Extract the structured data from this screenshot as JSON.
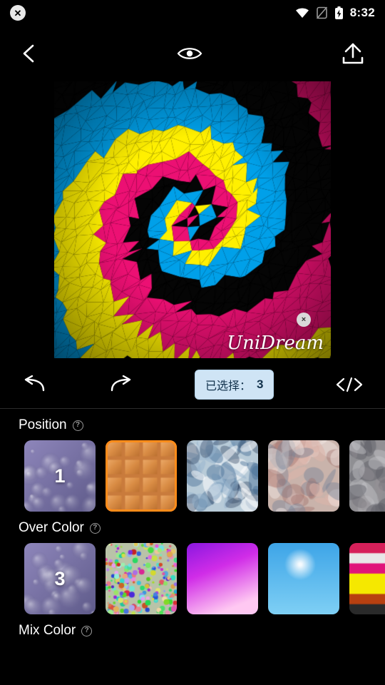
{
  "status_bar": {
    "close_icon": "close-circle-icon",
    "wifi_icon": "wifi-icon",
    "sim_icon": "sim-off-icon",
    "battery_icon": "battery-charging-icon",
    "time": "8:32"
  },
  "toolbar": {
    "back_icon": "chevron-left-icon",
    "preview_icon": "eye-icon",
    "share_icon": "upload-icon"
  },
  "canvas": {
    "watermark": "UniDream",
    "watermark_close": "×"
  },
  "action_bar": {
    "undo_icon": "undo-arrow-icon",
    "redo_icon": "redo-arrow-icon",
    "selected_label": "已选择：",
    "selected_count": "3",
    "code_icon": "code-brackets-icon"
  },
  "panel": {
    "sections": [
      {
        "title": "Position",
        "help": "?",
        "items": [
          {
            "name": "position-thumb-1",
            "badge": "1",
            "selected": false,
            "style": "bubbles-purple"
          },
          {
            "name": "position-thumb-2",
            "badge": "",
            "selected": true,
            "style": "waffle-orange"
          },
          {
            "name": "position-thumb-3",
            "badge": "",
            "selected": false,
            "style": "ice-blue"
          },
          {
            "name": "position-thumb-4",
            "badge": "",
            "selected": false,
            "style": "marble-pink"
          },
          {
            "name": "position-thumb-5",
            "badge": "",
            "selected": false,
            "style": "grey-rock"
          }
        ]
      },
      {
        "title": "Over Color",
        "help": "?",
        "items": [
          {
            "name": "overcolor-thumb-1",
            "badge": "3",
            "selected": false,
            "style": "bubbles-purple"
          },
          {
            "name": "overcolor-thumb-2",
            "badge": "",
            "selected": false,
            "style": "confetti"
          },
          {
            "name": "overcolor-thumb-3",
            "badge": "",
            "selected": false,
            "style": "magenta-gradient"
          },
          {
            "name": "overcolor-thumb-4",
            "badge": "",
            "selected": false,
            "style": "blue-moon"
          },
          {
            "name": "overcolor-thumb-5",
            "badge": "",
            "selected": false,
            "style": "color-stripes"
          }
        ]
      },
      {
        "title": "Mix Color",
        "help": "?",
        "items": []
      }
    ]
  },
  "colors": {
    "accent": "#ff8c1a",
    "pill_bg": "#cfe4f5",
    "pill_text": "#13334d",
    "background": "#000000"
  }
}
